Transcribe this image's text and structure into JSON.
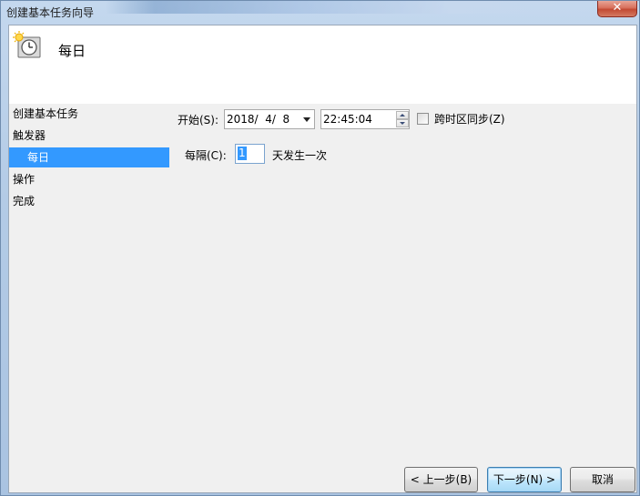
{
  "window": {
    "title": "创建基本任务向导",
    "close_label": "✕"
  },
  "header": {
    "title": "每日",
    "icon": "clock-icon"
  },
  "nav": {
    "items": [
      {
        "label": "创建基本任务",
        "selected": false
      },
      {
        "label": "触发器",
        "selected": false
      },
      {
        "label": "每日",
        "selected": true
      },
      {
        "label": "操作",
        "selected": false
      },
      {
        "label": "完成",
        "selected": false
      }
    ]
  },
  "form": {
    "start_label": "开始(S):",
    "start_date": "2018/  4/  8",
    "start_time": "22:45:04",
    "sync_label": "跨时区同步(Z)",
    "sync_checked": false,
    "recur_label": "每隔(C):",
    "recur_value": "1",
    "recur_suffix": "天发生一次"
  },
  "buttons": {
    "back": "< 上一步(B)",
    "next": "下一步(N) >",
    "cancel": "取消"
  },
  "colors": {
    "selection": "#3399ff",
    "window_bg": "#f0f0f0",
    "header_bg": "#ffffff"
  }
}
